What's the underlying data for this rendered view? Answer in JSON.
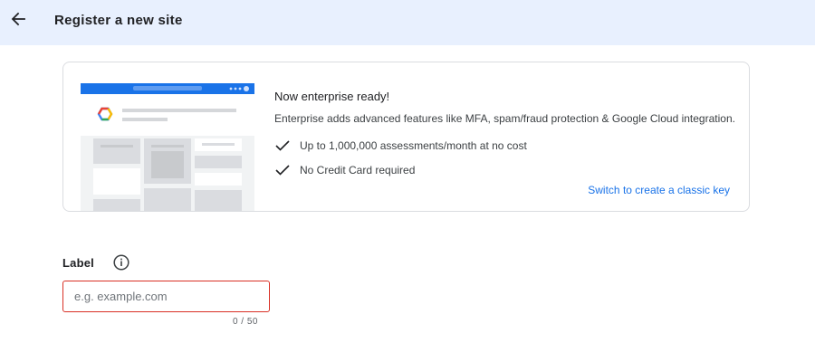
{
  "header": {
    "title": "Register a new site",
    "back_icon": "arrow-left-icon"
  },
  "promo": {
    "title": "Now enterprise ready!",
    "description": "Enterprise adds advanced features like MFA, spam/fraud protection & Google Cloud integration.",
    "features": [
      "Up to 1,000,000 assessments/month at no cost",
      "No Credit Card required"
    ],
    "switch_link": "Switch to create a classic key",
    "colors": {
      "link": "#1a73e8",
      "browser_bar": "#1a73e8"
    }
  },
  "form": {
    "label_title": "Label",
    "label_input": {
      "value": "",
      "placeholder": "e.g. example.com"
    },
    "char_count": "0 / 50",
    "error_color": "#d93025"
  }
}
